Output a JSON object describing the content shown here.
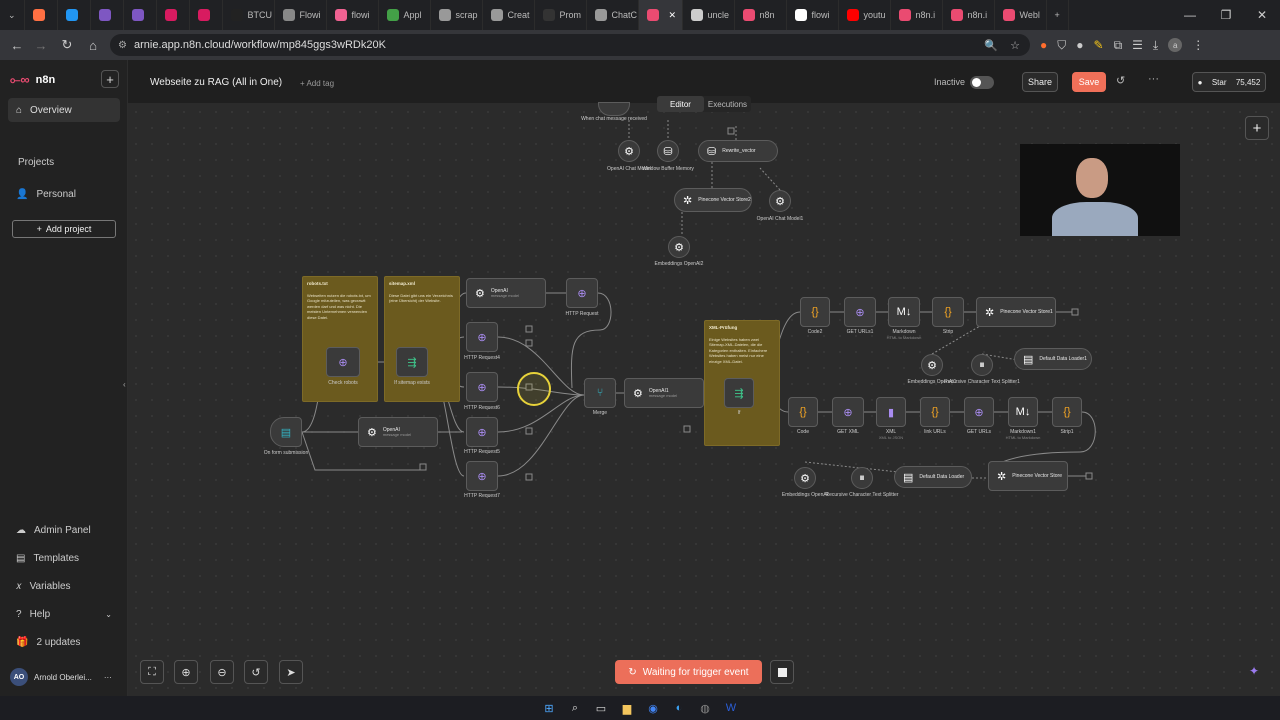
{
  "browser": {
    "tabs": [
      {
        "label": "",
        "color": "#ff7043",
        "active": false
      },
      {
        "label": "",
        "color": "#2196f3",
        "active": false
      },
      {
        "label": "",
        "color": "#7e57c2",
        "active": false
      },
      {
        "label": "",
        "color": "#7e57c2",
        "active": false
      },
      {
        "label": "",
        "color": "#d81b60",
        "active": false
      },
      {
        "label": "",
        "color": "#d81b60",
        "active": false
      },
      {
        "label": "BTCU",
        "color": "#222222",
        "active": false
      },
      {
        "label": "Flowi",
        "color": "#888888",
        "active": false
      },
      {
        "label": "flowi",
        "color": "#f06292",
        "active": false
      },
      {
        "label": "Appl",
        "color": "#43a047",
        "active": false
      },
      {
        "label": "scrap",
        "color": "#999999",
        "active": false
      },
      {
        "label": "Creat",
        "color": "#999999",
        "active": false
      },
      {
        "label": "Prom",
        "color": "#333333",
        "active": false
      },
      {
        "label": "ChatC",
        "color": "#999999",
        "active": false
      },
      {
        "label": "",
        "color": "#ea4b71",
        "active": true
      },
      {
        "label": "uncle",
        "color": "#cccccc",
        "active": false
      },
      {
        "label": "n8n",
        "color": "#ea4b71",
        "active": false
      },
      {
        "label": "flowi",
        "color": "#ffffff",
        "active": false
      },
      {
        "label": "youtu",
        "color": "#ff0000",
        "active": false
      },
      {
        "label": "n8n.i",
        "color": "#ea4b71",
        "active": false
      },
      {
        "label": "n8n.i",
        "color": "#ea4b71",
        "active": false
      },
      {
        "label": "Webl",
        "color": "#ea4b71",
        "active": false
      }
    ],
    "url": "arnie.app.n8n.cloud/workflow/mp845ggs3wRDk20K"
  },
  "sidebar": {
    "brand": "n8n",
    "overview": "Overview",
    "projects_heading": "Projects",
    "personal": "Personal",
    "add_project": "Add project",
    "admin_panel": "Admin Panel",
    "templates": "Templates",
    "variables": "Variables",
    "help": "Help",
    "updates": "2 updates",
    "user_initials": "AO",
    "user_name": "Arnold Oberlei..."
  },
  "header": {
    "workflow_name": "Webseite zu RAG (All in One)",
    "add_tag": "+ Add tag",
    "status": "Inactive",
    "share": "Share",
    "save": "Save",
    "star": "Star",
    "star_count": "75,452"
  },
  "canvas_tabs": {
    "editor": "Editor",
    "executions": "Executions"
  },
  "nodes": {
    "chat_trigger": "When chat message received",
    "openai_chat_model": "OpenAI Chat Model",
    "window_buffer": "Window Buffer Memory",
    "pinecone_vector_store2": "Pinecone Vector Store2",
    "openai_chat_model1": "OpenAI Chat Model1",
    "embeddings_openai2": "Embeddings OpenAI2",
    "retrieve_vector": "Rewrite_vector",
    "openai_top": "OpenAI",
    "openai_top_sub": "message model",
    "http_request": "HTTP Request",
    "http_request4": "HTTP Request4",
    "http_request6": "HTTP Request6",
    "http_request5": "HTTP Request5",
    "http_request7": "HTTP Request7",
    "check_robots": "Check robots",
    "if_sitemap": "If sitemap exists",
    "on_form": "On form submission",
    "openai0": "OpenAI",
    "openai0_sub": "message model",
    "merge": "Merge",
    "openai1": "OpenAI1",
    "openai1_sub": "message model",
    "if": "If",
    "code2": "Code2",
    "get_urls1": "GET URLs1",
    "markdown": "Markdown",
    "markdown_sub": "HTML to Markdown",
    "strip": "Strip",
    "pinecone_vector_store1": "Pinecone Vector Store1",
    "embeddings_openai1": "Embeddings OpenAI1",
    "recursive_splitter1": "Recursive Character Text Splitter1",
    "default_data_loader1": "Default Data Loader1",
    "code": "Code",
    "get_xml": "GET XML",
    "xml": "XML",
    "xml_sub": "XML to JSON",
    "link_urls": "link URLs",
    "get_urls": "GET URLs",
    "markdown1": "Markdown1",
    "markdown1_sub": "HTML to Markdown",
    "strip1": "Strip1",
    "embeddings_openai": "Embeddings OpenAI",
    "recursive_splitter": "Recursive Character Text Splitter",
    "default_data_loader": "Default Data Loader",
    "pinecone_vector_store": "Pinecone Vector Store"
  },
  "stickies": {
    "robots_title": "robots.txt",
    "robots_text": "Webseiten nutzen die robots.txt, um Google mitzuteilen, was gecrawlt werden darf und was nicht. Die meisten Unternehmen verwenden diese Datei.",
    "sitemap_title": "sitemap.xml",
    "sitemap_text": "Diese Datei gibt uns ein Verzeichnis (eine Übersicht) der Website.",
    "xml_title": "XML-Prüfung",
    "xml_text": "Einige Websites haben zwei Sitemap-XML-Dateien, die die Kategorien enthalten. Einfachere Websites haben meist nur eine einzige XML-Datei."
  },
  "bottom": {
    "waiting": "Waiting for trigger event"
  },
  "icons": {
    "openai": "openai-icon",
    "globe": "globe-icon",
    "code": "code-icon",
    "if": "if-branch-icon",
    "merge": "merge-icon"
  },
  "colors": {
    "accent": "#ea4b71",
    "save": "#f07059",
    "sticky": "#6b5a1e"
  }
}
